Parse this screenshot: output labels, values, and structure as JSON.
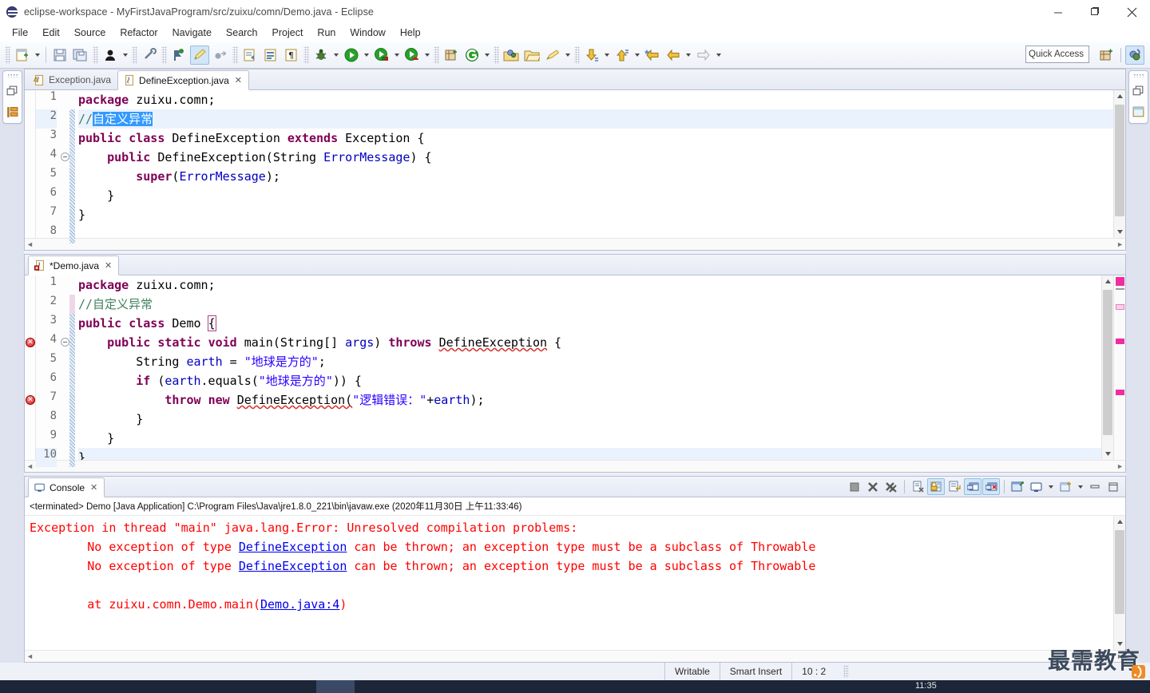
{
  "window": {
    "title": "eclipse-workspace - MyFirstJavaProgram/src/zuixu/comn/Demo.java - Eclipse",
    "minimize_label": "Minimize",
    "maximize_label": "Restore",
    "close_label": "Close"
  },
  "menu": {
    "items": [
      "File",
      "Edit",
      "Source",
      "Refactor",
      "Navigate",
      "Search",
      "Project",
      "Run",
      "Window",
      "Help"
    ]
  },
  "toolbar": {
    "quick_access_placeholder": "Quick Access",
    "buttons": [
      {
        "name": "new-wizard",
        "icon": "new-file-icon"
      },
      {
        "name": "save",
        "icon": "save-icon"
      },
      {
        "name": "save-all",
        "icon": "save-all-icon"
      },
      {
        "name": "new-java-class",
        "icon": "person-icon"
      },
      {
        "name": "skip-breakpoints",
        "icon": "skip-breakpoints-icon"
      },
      {
        "name": "toggle-mark-occurrences",
        "icon": "mark-occurrences-icon"
      },
      {
        "name": "pencil",
        "icon": "pencil-icon"
      },
      {
        "name": "link-editor",
        "icon": "link-icon"
      },
      {
        "name": "open-task",
        "icon": "task-icon"
      },
      {
        "name": "open-type",
        "icon": "open-type-icon"
      },
      {
        "name": "paragraph",
        "icon": "paragraph-icon"
      },
      {
        "name": "debug",
        "icon": "bug-icon"
      },
      {
        "name": "run",
        "icon": "run-icon"
      },
      {
        "name": "coverage",
        "icon": "coverage-icon"
      },
      {
        "name": "profile",
        "icon": "profile-icon"
      },
      {
        "name": "new-java-project",
        "icon": "project-icon"
      },
      {
        "name": "new-package",
        "icon": "package-icon"
      },
      {
        "name": "open-search",
        "icon": "search-folder-icon"
      },
      {
        "name": "open-folder",
        "icon": "folder-icon"
      },
      {
        "name": "marker",
        "icon": "marker-icon"
      },
      {
        "name": "next-annotation",
        "icon": "down-arrow-icon"
      },
      {
        "name": "prev-annotation",
        "icon": "up-arrow-icon"
      },
      {
        "name": "back-history",
        "icon": "back-star-icon"
      },
      {
        "name": "back",
        "icon": "back-arrow-icon"
      },
      {
        "name": "forward",
        "icon": "forward-arrow-icon"
      }
    ],
    "perspective_new": "new-perspective-icon",
    "perspective_java": "java-perspective-icon"
  },
  "left_strip": {
    "icons": [
      "restore-icon",
      "package-explorer-icon"
    ]
  },
  "right_strip": {
    "icons": [
      "restore-icon",
      "outline-icon"
    ]
  },
  "editor_top": {
    "tabs": [
      {
        "label": "Exception.java",
        "active": false,
        "dirty": false,
        "icon": "java-warning-icon",
        "closable": false
      },
      {
        "label": "DefineException.java",
        "active": true,
        "dirty": false,
        "icon": "java-file-icon",
        "closable": true
      }
    ],
    "lines": [
      {
        "num": "1",
        "segments": [
          {
            "t": "package",
            "c": "kw"
          },
          {
            "t": " zuixu.comn;",
            "c": ""
          }
        ]
      },
      {
        "num": "2",
        "highlight": true,
        "segments": [
          {
            "t": "//",
            "c": "cm"
          },
          {
            "t": "自定义异常",
            "c": "sel"
          }
        ]
      },
      {
        "num": "3",
        "segments": [
          {
            "t": "public",
            "c": "kw"
          },
          {
            "t": " ",
            "c": ""
          },
          {
            "t": "class",
            "c": "kw"
          },
          {
            "t": " DefineException ",
            "c": ""
          },
          {
            "t": "extends",
            "c": "kw"
          },
          {
            "t": " Exception {",
            "c": ""
          }
        ]
      },
      {
        "num": "4",
        "fold": true,
        "segments": [
          {
            "t": "    ",
            "c": ""
          },
          {
            "t": "public",
            "c": "kw"
          },
          {
            "t": " DefineException(",
            "c": ""
          },
          {
            "t": "String",
            "c": ""
          },
          {
            "t": " ",
            "c": ""
          },
          {
            "t": "ErrorMessage",
            "c": "fld"
          },
          {
            "t": ") {",
            "c": ""
          }
        ]
      },
      {
        "num": "5",
        "segments": [
          {
            "t": "        ",
            "c": ""
          },
          {
            "t": "super",
            "c": "kw"
          },
          {
            "t": "(",
            "c": ""
          },
          {
            "t": "ErrorMessage",
            "c": "fld"
          },
          {
            "t": ");",
            "c": ""
          }
        ]
      },
      {
        "num": "6",
        "segments": [
          {
            "t": "    }",
            "c": ""
          }
        ]
      },
      {
        "num": "7",
        "segments": [
          {
            "t": "}",
            "c": ""
          }
        ]
      },
      {
        "num": "8",
        "segments": [
          {
            "t": "",
            "c": ""
          }
        ]
      }
    ]
  },
  "editor_bottom": {
    "tabs": [
      {
        "label": "*Demo.java",
        "active": true,
        "dirty": true,
        "icon": "java-error-icon",
        "closable": true
      }
    ],
    "lines": [
      {
        "num": "1",
        "segments": [
          {
            "t": "package",
            "c": "kw"
          },
          {
            "t": " zuixu.comn;",
            "c": ""
          }
        ]
      },
      {
        "num": "2",
        "changed": "pink",
        "segments": [
          {
            "t": "//自定义异常",
            "c": "cm"
          }
        ]
      },
      {
        "num": "3",
        "segments": [
          {
            "t": "public",
            "c": "kw"
          },
          {
            "t": " ",
            "c": ""
          },
          {
            "t": "class",
            "c": "kw"
          },
          {
            "t": " Demo ",
            "c": ""
          },
          {
            "t": "{",
            "c": "brace"
          }
        ]
      },
      {
        "num": "4",
        "error": true,
        "fold": true,
        "segments": [
          {
            "t": "    ",
            "c": ""
          },
          {
            "t": "public",
            "c": "kw"
          },
          {
            "t": " ",
            "c": ""
          },
          {
            "t": "static",
            "c": "kw"
          },
          {
            "t": " ",
            "c": ""
          },
          {
            "t": "void",
            "c": "kw"
          },
          {
            "t": " main(",
            "c": ""
          },
          {
            "t": "String",
            "c": ""
          },
          {
            "t": "[] ",
            "c": ""
          },
          {
            "t": "args",
            "c": "arg"
          },
          {
            "t": ") ",
            "c": ""
          },
          {
            "t": "throws",
            "c": "kw"
          },
          {
            "t": " ",
            "c": ""
          },
          {
            "t": "DefineException",
            "c": "errwave"
          },
          {
            "t": " {",
            "c": ""
          }
        ]
      },
      {
        "num": "5",
        "segments": [
          {
            "t": "        ",
            "c": ""
          },
          {
            "t": "String",
            "c": ""
          },
          {
            "t": " ",
            "c": ""
          },
          {
            "t": "earth",
            "c": "arg"
          },
          {
            "t": " = ",
            "c": ""
          },
          {
            "t": "\"地球是方的\"",
            "c": "st"
          },
          {
            "t": ";",
            "c": ""
          }
        ]
      },
      {
        "num": "6",
        "segments": [
          {
            "t": "        ",
            "c": ""
          },
          {
            "t": "if",
            "c": "kw"
          },
          {
            "t": " (",
            "c": ""
          },
          {
            "t": "earth",
            "c": "arg"
          },
          {
            "t": ".equals(",
            "c": ""
          },
          {
            "t": "\"地球是方的\"",
            "c": "st"
          },
          {
            "t": ")) {",
            "c": ""
          }
        ]
      },
      {
        "num": "7",
        "error": true,
        "segments": [
          {
            "t": "            ",
            "c": ""
          },
          {
            "t": "throw",
            "c": "kw"
          },
          {
            "t": " ",
            "c": ""
          },
          {
            "t": "new",
            "c": "kw"
          },
          {
            "t": " ",
            "c": ""
          },
          {
            "t": "DefineException(",
            "c": "errwave"
          },
          {
            "t": "\"逻辑错误：\"",
            "c": "st"
          },
          {
            "t": "+",
            "c": ""
          },
          {
            "t": "earth",
            "c": "arg"
          },
          {
            "t": ");",
            "c": ""
          }
        ]
      },
      {
        "num": "8",
        "segments": [
          {
            "t": "        }",
            "c": ""
          }
        ]
      },
      {
        "num": "9",
        "segments": [
          {
            "t": "    }",
            "c": ""
          }
        ]
      },
      {
        "num": "10",
        "highlight": true,
        "segments": [
          {
            "t": "}",
            "c": ""
          }
        ]
      }
    ]
  },
  "console": {
    "tab_label": "Console",
    "terminated_line": "<terminated> Demo [Java Application] C:\\Program Files\\Java\\jre1.8.0_221\\bin\\javaw.exe (2020年11月30日 上午11:33:46)",
    "tools": [
      {
        "name": "terminate",
        "icon": "stop-icon",
        "active": false
      },
      {
        "name": "remove-launch",
        "icon": "remove-icon",
        "active": false
      },
      {
        "name": "remove-all-launches",
        "icon": "remove-all-icon",
        "active": false
      },
      {
        "name": "clear-console",
        "icon": "clear-console-icon",
        "active": false
      },
      {
        "name": "scroll-lock",
        "icon": "lock-icon",
        "active": true
      },
      {
        "name": "word-wrap",
        "icon": "word-wrap-icon",
        "active": false
      },
      {
        "name": "show-console-on-output",
        "icon": "show-output-icon",
        "active": true
      },
      {
        "name": "show-console-on-error",
        "icon": "show-error-icon",
        "active": true
      },
      {
        "name": "pin-console",
        "icon": "pin-icon",
        "active": false
      },
      {
        "name": "display-selected-console",
        "icon": "display-console-icon",
        "active": false
      },
      {
        "name": "open-console",
        "icon": "open-console-icon",
        "active": false
      },
      {
        "name": "minimize",
        "icon": "minimize-icon",
        "active": false
      },
      {
        "name": "maximize",
        "icon": "maximize-icon",
        "active": false
      }
    ],
    "output": [
      {
        "segments": [
          {
            "t": "Exception in thread \"main\" java.lang.Error: Unresolved compilation problems: ",
            "c": "err"
          }
        ]
      },
      {
        "segments": [
          {
            "t": "\tNo exception of type ",
            "c": "err"
          },
          {
            "t": "DefineException",
            "c": "link"
          },
          {
            "t": " can be thrown; an exception type must be a subclass of Throwable",
            "c": "err"
          }
        ]
      },
      {
        "segments": [
          {
            "t": "\tNo exception of type ",
            "c": "err"
          },
          {
            "t": "DefineException",
            "c": "link"
          },
          {
            "t": " can be thrown; an exception type must be a subclass of Throwable",
            "c": "err"
          }
        ]
      },
      {
        "segments": [
          {
            "t": "",
            "c": "err"
          }
        ]
      },
      {
        "segments": [
          {
            "t": "\tat zuixu.comn.Demo.main(",
            "c": "err"
          },
          {
            "t": "Demo.java:4",
            "c": "link"
          },
          {
            "t": ")",
            "c": "err"
          }
        ]
      }
    ]
  },
  "statusbar": {
    "writable": "Writable",
    "insert_mode": "Smart Insert",
    "position": "10 : 2"
  },
  "watermark": {
    "text": "最需教育"
  },
  "taskbar": {
    "time": "11:35"
  },
  "colors": {
    "keyword": "#7f0055",
    "comment": "#3f7f5f",
    "string": "#2a00ff",
    "field": "#0000c0",
    "error": "#ff0000",
    "link": "#0000ee",
    "selection": "#3399ff",
    "accent": "#92bfe3"
  }
}
